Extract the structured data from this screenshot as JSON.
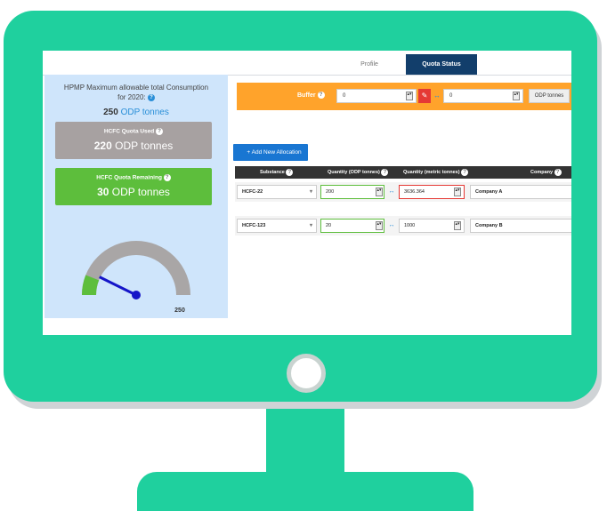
{
  "tabs": [
    {
      "label": "Profile",
      "active": false
    },
    {
      "label": "Quota Status",
      "active": true
    }
  ],
  "summary": {
    "title_line1": "HPMP Maximum allowable total Consumption",
    "title_line2": "for 2020:",
    "total_value": "250",
    "total_unit": "ODP tonnes"
  },
  "used": {
    "label": "HCFC Quota Used",
    "value": "220",
    "unit": "ODP tonnes"
  },
  "remaining": {
    "label": "HCFC Quota Remaining",
    "value": "30",
    "unit": "ODP tonnes"
  },
  "gauge": {
    "max_label": "250",
    "max": 250,
    "value": 30
  },
  "buffer": {
    "label": "Buffer",
    "value_left": "0",
    "value_right": "0",
    "unit": "ODP tonnes"
  },
  "add_button": "Add New Allocation",
  "table": {
    "headers": [
      "Substance",
      "Quantity (ODP tonnes)",
      "Quantity (metric tonnes)",
      "Company"
    ],
    "rows": [
      {
        "substance": "HCFC-22",
        "odp": "200",
        "metric": "3636.364",
        "company": "Company A"
      },
      {
        "substance": "HCFC-123",
        "odp": "20",
        "metric": "1000",
        "company": "Company B"
      }
    ]
  },
  "colors": {
    "monitor": "#1fd09e",
    "tab_active": "#123e6b",
    "buffer": "#ffa32b",
    "used": "#a7a1a1",
    "remaining": "#5dbe3c",
    "accent": "#1976d2"
  }
}
